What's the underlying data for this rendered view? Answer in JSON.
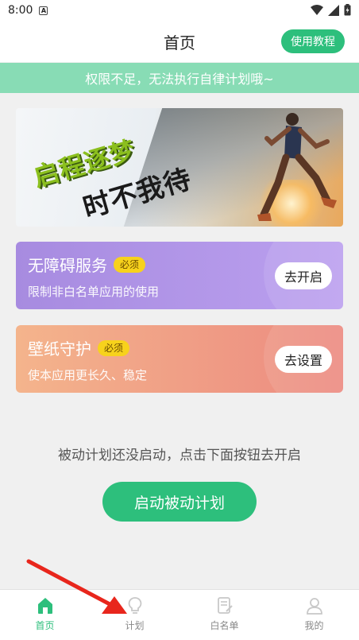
{
  "status_bar": {
    "time": "8:00",
    "notification": "A"
  },
  "header": {
    "title": "首页",
    "tutorial_label": "使用教程"
  },
  "warning": {
    "text": "权限不足，无法执行自律计划哦~"
  },
  "banner": {
    "line1": "启程逐梦",
    "line2": "时不我待"
  },
  "cards": [
    {
      "title": "无障碍服务",
      "badge": "必须",
      "subtitle": "限制非白名单应用的使用",
      "button": "去开启"
    },
    {
      "title": "壁纸守护",
      "badge": "必须",
      "subtitle": "使本应用更长久、稳定",
      "button": "去设置"
    }
  ],
  "plan": {
    "status_text": "被动计划还没启动，点击下面按钮去开启",
    "start_button": "启动被动计划"
  },
  "nav": {
    "items": [
      {
        "label": "首页",
        "icon": "home-icon",
        "active": true
      },
      {
        "label": "计划",
        "icon": "lightbulb-icon",
        "active": false
      },
      {
        "label": "白名单",
        "icon": "whitelist-icon",
        "active": false
      },
      {
        "label": "我的",
        "icon": "user-icon",
        "active": false
      }
    ]
  },
  "colors": {
    "accent": "#2dbf7c",
    "warning_bg": "#88dcb5",
    "badge": "#f7d21c",
    "arrow": "#e8261c"
  }
}
